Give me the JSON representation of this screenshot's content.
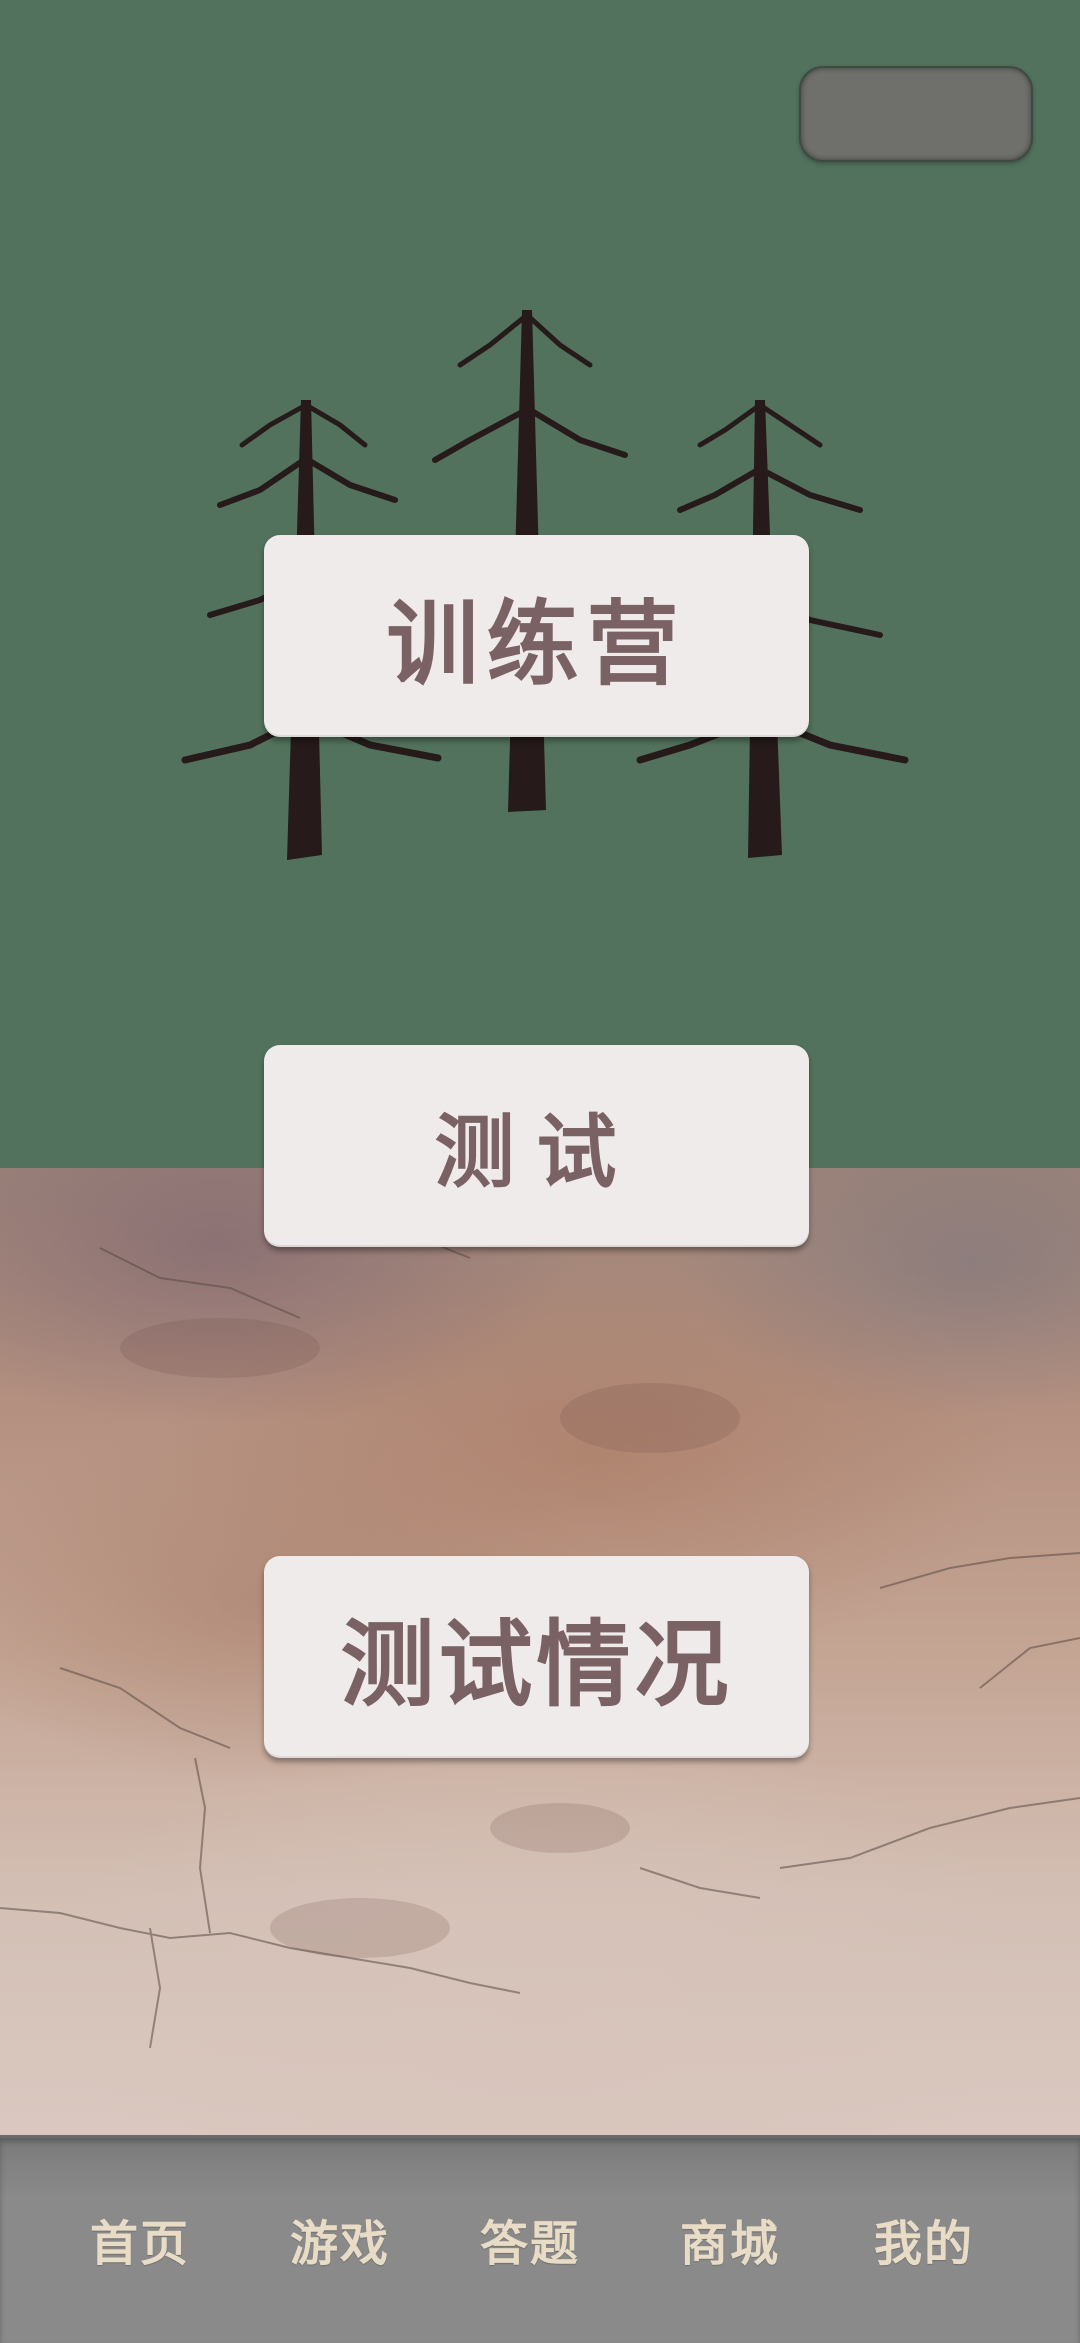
{
  "menu": {
    "training": "训练营",
    "test": "测试",
    "test_report": "测试情况"
  },
  "bottom_nav": {
    "items": [
      {
        "label": "首页"
      },
      {
        "label": "游戏"
      },
      {
        "label": "答题"
      },
      {
        "label": "商城"
      },
      {
        "label": "我的"
      }
    ]
  },
  "theme": {
    "top_background": "#52725d",
    "button_background": "#f0ebeb",
    "button_text": "#7a6264",
    "nav_background": "#8a8a8a",
    "nav_text": "#e8dcc6",
    "tree_color": "#261a1a"
  },
  "icons": [
    "settings-pill",
    "pine-trees-illustration"
  ]
}
